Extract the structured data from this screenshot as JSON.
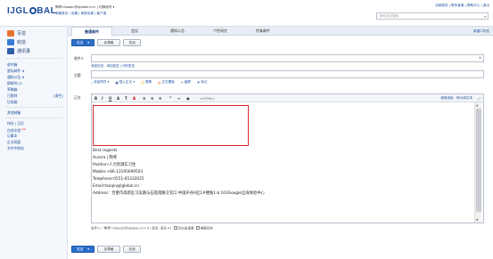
{
  "header": {
    "logo": {
      "pre": "IJGL",
      "post": "BAL"
    },
    "user_line": "陶琴<taoqin@lglobal.cn>  |  切换帐号 ▾",
    "user_links": "邮箱首页 | 设置 | 换肤效果 | 客户端",
    "top_right": "自助服务 | 联系客服 | 帮助中心 | 退出",
    "search_placeholder": "邮件全文搜索"
  },
  "sidebar": {
    "main": [
      {
        "label": "写信",
        "color": "#e8732d"
      },
      {
        "label": "收信",
        "color": "#3a7bd5"
      },
      {
        "label": "通讯录",
        "color": "#2f5ea8"
      }
    ],
    "folders": [
      {
        "label": "收件箱"
      },
      {
        "label": "星标邮件 ★",
        "star": true
      },
      {
        "label": "通知公告 ★",
        "star": true
      },
      {
        "label": "群邮件(1)"
      },
      {
        "label": "草稿箱"
      },
      {
        "label": "已删除",
        "count": "[清空]"
      },
      {
        "label": "垃圾箱"
      }
    ],
    "other_label": "其他邮箱",
    "tools": [
      {
        "label": "待办 | 日历"
      },
      {
        "label": "在线文档",
        "badge": "new"
      },
      {
        "label": "记事本"
      },
      {
        "label": "企业网盘"
      },
      {
        "label": "文件中转站"
      }
    ]
  },
  "tabs": {
    "items": [
      "普通邮件",
      "会议",
      "通知公告",
      "个性研究",
      "传真邮件"
    ],
    "right": "新窗口写信"
  },
  "toolbar": {
    "send": "发送",
    "save_draft": "存草稿",
    "close": "关闭"
  },
  "form": {
    "to_label": "收件人",
    "cc_links": "添加抄送 - 添加密送 | 分别发送",
    "subject_label": "主题",
    "body_label": "正文",
    "attach_items": [
      "添加附件 ▾",
      "插入正文 ▾",
      "表情",
      "正文模板",
      "截屏",
      "标记"
    ]
  },
  "editor": {
    "toolbar_items": [
      "B",
      "I",
      "U",
      "A",
      "T",
      "A",
      "≡",
      "≡",
      "≡",
      "”",
      "∞"
    ],
    "html_mode": "<HTML>",
    "right_links": "使用信纸   · 转为纯文本",
    "signature": [
      "Best regards",
      "Aurora | 陶琴",
      "Position:人力资源实习生",
      "Mobile:+86-13195699503",
      "Telephone:0551-65332025",
      "Email:taoqin@lglobal.cn",
      "Address：合肥市高新区习友路与石莲南路交叉口 中国声谷A区1#楼独1-b 103Google出海体验中心"
    ]
  },
  "sender": {
    "text": "发件人:  \"陶琴\"<taoqin@lglobal.cn> ▾  |  签名: 签名 ▾  |",
    "option1": "优先级重要",
    "option2": "需要回执"
  },
  "colors": {
    "accent": "#2b6fcb",
    "highlight": "#d9282b"
  }
}
